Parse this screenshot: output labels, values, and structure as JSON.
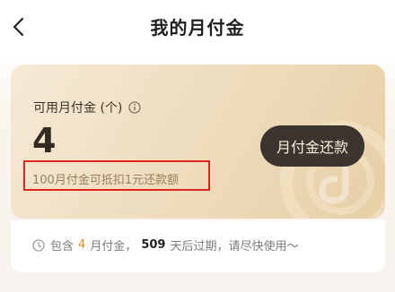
{
  "header": {
    "title": "我的月付金",
    "back_icon": "chevron-left-icon"
  },
  "card": {
    "label": "可用月付金 (个)",
    "info_icon": "info-icon",
    "count": "4",
    "repay_button_label": "月付金还款",
    "note": "100月付金可抵扣1元还款额",
    "note_highlighted": true,
    "highlight_color": "#e0231c"
  },
  "expiry": {
    "clock_icon": "clock-icon",
    "prefix": "包含",
    "count": "4",
    "mid": "月付金，",
    "days": "509",
    "suffix": "天后过期，请尽快使用～"
  },
  "colors": {
    "accent_orange": "#e88a2a",
    "button_dark": "#3b342f",
    "card_gold": "#efdfc2"
  }
}
